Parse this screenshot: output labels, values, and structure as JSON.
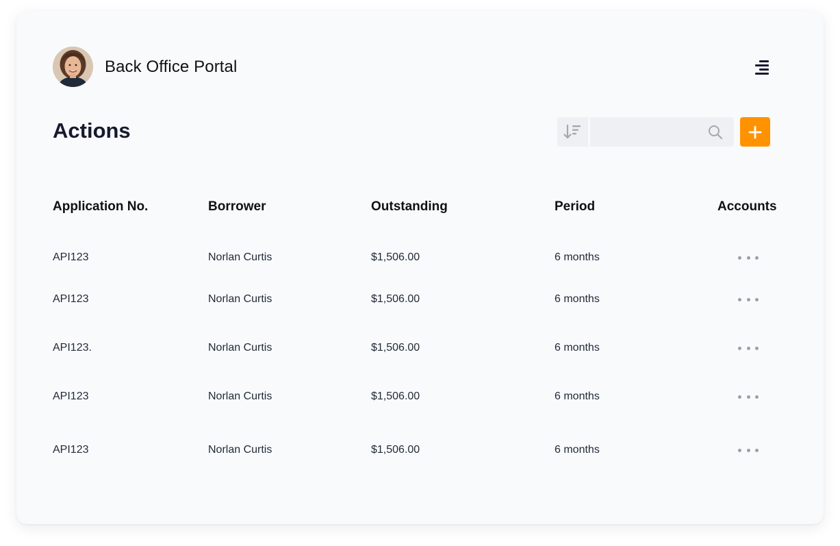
{
  "app": {
    "title": "Back Office Portal"
  },
  "page": {
    "title": "Actions"
  },
  "toolbar": {
    "search_value": "",
    "search_placeholder": "",
    "accent_color": "#ff9200"
  },
  "icons": {
    "menu": "menu-icon",
    "sort": "sort-descending-icon",
    "search": "search-icon",
    "add": "plus-icon",
    "more": "more-horizontal-icon"
  },
  "table": {
    "columns": [
      "Application No.",
      "Borrower",
      "Outstanding",
      "Period",
      "Accounts"
    ],
    "rows": [
      {
        "application_no": "API123",
        "borrower": "Norlan Curtis",
        "outstanding": "$1,506.00",
        "period": "6 months"
      },
      {
        "application_no": "API123",
        "borrower": "Norlan Curtis",
        "outstanding": "$1,506.00",
        "period": "6 months"
      },
      {
        "application_no": "API123.",
        "borrower": "Norlan Curtis",
        "outstanding": "$1,506.00",
        "period": "6 months"
      },
      {
        "application_no": "API123",
        "borrower": "Norlan Curtis",
        "outstanding": "$1,506.00",
        "period": "6 months"
      },
      {
        "application_no": "API123",
        "borrower": "Norlan Curtis",
        "outstanding": "$1,506.00",
        "period": "6 months"
      }
    ]
  }
}
